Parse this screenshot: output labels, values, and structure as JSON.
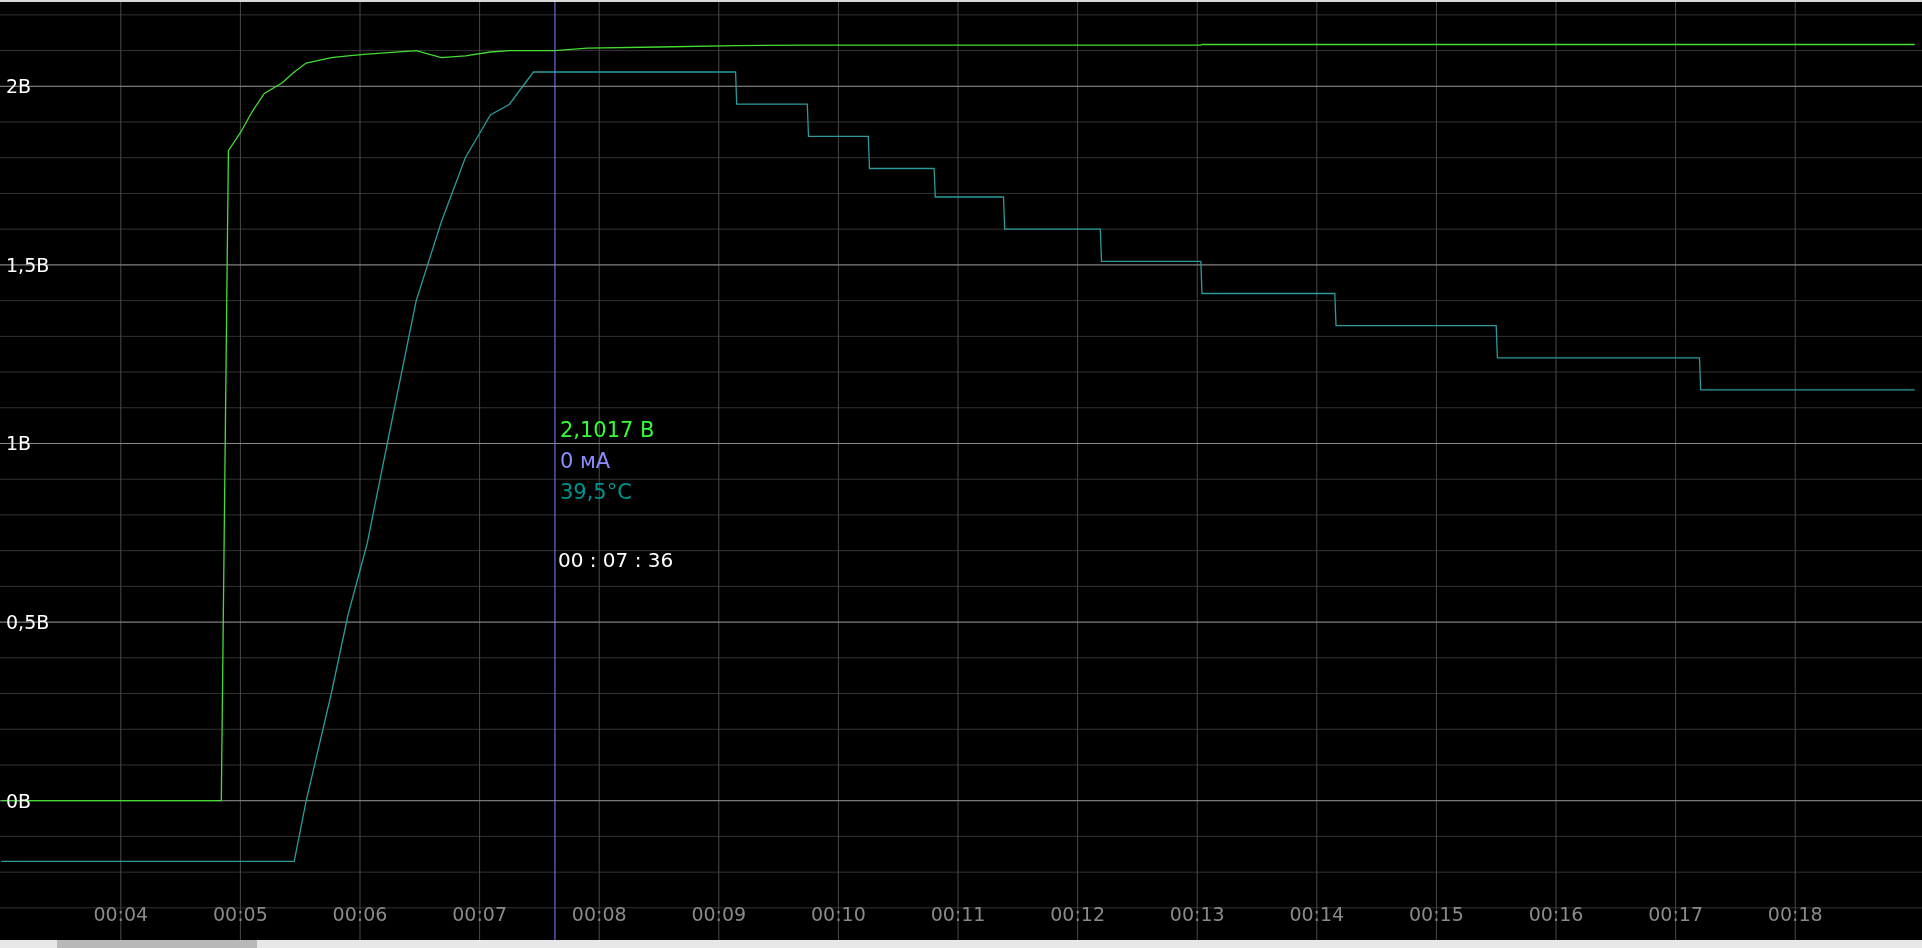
{
  "chart_data": {
    "type": "line",
    "xlim": [
      2.99,
      19.06
    ],
    "ylim": [
      -0.39,
      2.236
    ],
    "x": [
      3.0,
      4.84,
      4.9,
      5.0,
      5.1,
      5.2,
      5.35,
      5.45,
      5.55,
      5.76,
      5.9,
      6.06,
      6.27,
      6.47,
      6.68,
      6.88,
      7.09,
      7.25,
      7.45,
      7.63,
      7.9,
      8.5,
      9.14,
      9.15,
      9.74,
      9.75,
      10.25,
      10.26,
      10.8,
      10.81,
      11.38,
      11.39,
      12.19,
      12.2,
      13.03,
      13.04,
      14.15,
      14.16,
      15.5,
      15.51,
      17.2,
      17.21,
      19.0
    ],
    "series": [
      {
        "color": "#44dd33",
        "values": [
          0,
          0,
          1.82,
          1.87,
          1.93,
          1.98,
          2.01,
          2.04,
          2.065,
          2.08,
          2.085,
          2.09,
          2.095,
          2.1,
          2.08,
          2.085,
          2.096,
          2.1,
          2.1,
          2.1,
          2.107,
          2.11,
          2.114,
          2.114,
          2.115,
          2.115,
          2.115,
          2.115,
          2.115,
          2.115,
          2.115,
          2.115,
          2.115,
          2.115,
          2.115,
          2.117,
          2.117,
          2.117,
          2.117,
          2.117,
          2.117,
          2.117,
          2.117
        ]
      },
      {
        "color": "#2a9a9a",
        "values": [
          -0.17,
          -0.17,
          -0.17,
          -0.17,
          -0.17,
          -0.17,
          -0.17,
          -0.17,
          0.0,
          0.3,
          0.52,
          0.72,
          1.07,
          1.4,
          1.62,
          1.8,
          1.92,
          1.95,
          2.04,
          2.04,
          2.04,
          2.04,
          2.04,
          1.95,
          1.95,
          1.86,
          1.86,
          1.77,
          1.77,
          1.69,
          1.69,
          1.6,
          1.6,
          1.51,
          1.51,
          1.42,
          1.42,
          1.33,
          1.33,
          1.24,
          1.24,
          1.15,
          1.15
        ]
      }
    ],
    "xticks": [
      {
        "value": 4,
        "label": "00:04"
      },
      {
        "value": 5,
        "label": "00:05"
      },
      {
        "value": 6,
        "label": "00:06"
      },
      {
        "value": 7,
        "label": "00:07"
      },
      {
        "value": 8,
        "label": "00:08"
      },
      {
        "value": 9,
        "label": "00:09"
      },
      {
        "value": 10,
        "label": "00:10"
      },
      {
        "value": 11,
        "label": "00:11"
      },
      {
        "value": 12,
        "label": "00:12"
      },
      {
        "value": 13,
        "label": "00:13"
      },
      {
        "value": 14,
        "label": "00:14"
      },
      {
        "value": 15,
        "label": "00:15"
      },
      {
        "value": 16,
        "label": "00:16"
      },
      {
        "value": 17,
        "label": "00:17"
      },
      {
        "value": 18,
        "label": "00:18"
      }
    ],
    "yticks": [
      {
        "value": 0,
        "label": "0В"
      },
      {
        "value": 0.5,
        "label": "0,5В"
      },
      {
        "value": 1,
        "label": "1В"
      },
      {
        "value": 1.5,
        "label": "1,5В"
      },
      {
        "value": 2,
        "label": "2В"
      }
    ],
    "grid": true,
    "ref_lines": [
      {
        "axis": "x",
        "value": 7.63,
        "color": "#8080ff"
      }
    ]
  },
  "cursor_readout": {
    "values": [
      {
        "text": "2,1017 В",
        "color": "#33ff33"
      },
      {
        "text": "0 мА",
        "color": "#8c8cff"
      },
      {
        "text": "39,5°C",
        "color": "#00948f"
      }
    ],
    "time": "00 : 07 : 36"
  }
}
